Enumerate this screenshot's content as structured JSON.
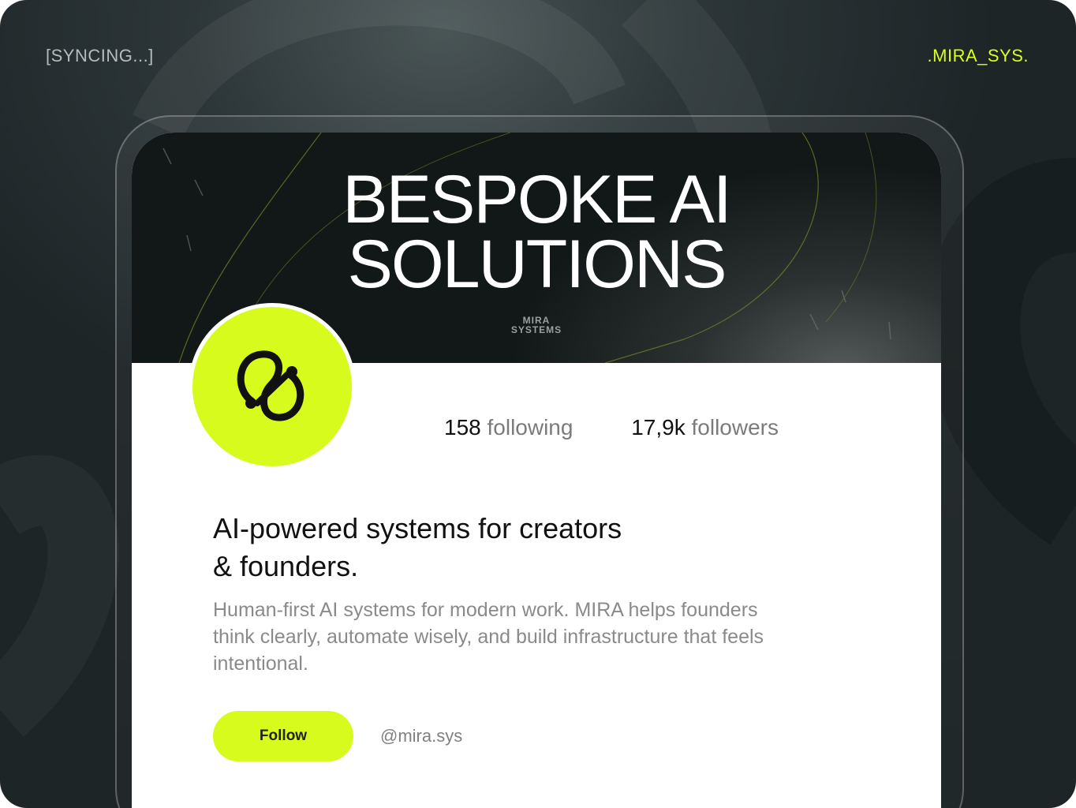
{
  "corners": {
    "status_text": "[SYNCING...]",
    "brand_text": ".MIRA_SYS."
  },
  "banner": {
    "headline_line1": "BESPOKE AI",
    "headline_line2": "SOLUTIONS",
    "logo_line1": "MIRA",
    "logo_line2": "SYSTEMS"
  },
  "profile": {
    "following_count": "158",
    "following_label": "following",
    "followers_count": "17,9k",
    "followers_label": "followers",
    "bio_title_line1": "AI-powered systems for creators",
    "bio_title_line2": "& founders.",
    "bio_text": "Human-first AI systems for modern work. MIRA helps founders think clearly, automate wisely, and build infrastructure that feels intentional.",
    "follow_label": "Follow",
    "handle": "@mira.sys"
  },
  "colors": {
    "accent": "#d6fb1d",
    "background": "#1d2527"
  },
  "icons": {
    "avatar": "mira-knot-logo-icon"
  }
}
